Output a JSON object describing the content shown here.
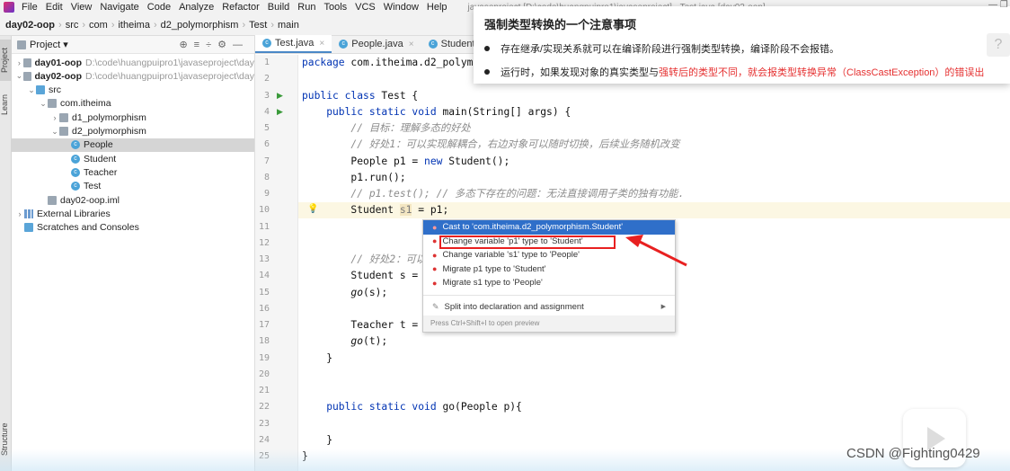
{
  "menubar": {
    "items": [
      "File",
      "Edit",
      "View",
      "Navigate",
      "Code",
      "Analyze",
      "Refactor",
      "Build",
      "Run",
      "Tools",
      "VCS",
      "Window",
      "Help"
    ],
    "window_title": "javaseproject [D:\\code\\huangpuipro1\\javaseproject] - Test.java [day02-oop]"
  },
  "breadcrumb": [
    "day02-oop",
    "src",
    "com",
    "itheima",
    "d2_polymorphism",
    "Test",
    "main"
  ],
  "leftstrip": {
    "project": "Project",
    "learn": "Learn",
    "structure": "Structure"
  },
  "project": {
    "title": "Project ▾",
    "tree": [
      {
        "label": "day01-oop",
        "path": "D:\\code\\huangpuipro1\\javaseproject\\day",
        "arrow": "›",
        "icon": "module",
        "bold": true,
        "depth": 0
      },
      {
        "label": "day02-oop",
        "path": "D:\\code\\huangpuipro1\\javaseproject\\day",
        "arrow": "⌄",
        "icon": "module",
        "bold": true,
        "depth": 0
      },
      {
        "label": "src",
        "arrow": "⌄",
        "icon": "src",
        "depth": 1
      },
      {
        "label": "com.itheima",
        "arrow": "⌄",
        "icon": "folder",
        "depth": 2
      },
      {
        "label": "d1_polymorphism",
        "arrow": "›",
        "icon": "folder",
        "depth": 3
      },
      {
        "label": "d2_polymorphism",
        "arrow": "⌄",
        "icon": "folder",
        "depth": 3
      },
      {
        "label": "People",
        "icon": "class",
        "depth": 4,
        "selected": true
      },
      {
        "label": "Student",
        "icon": "class",
        "depth": 4
      },
      {
        "label": "Teacher",
        "icon": "class",
        "depth": 4
      },
      {
        "label": "Test",
        "icon": "class",
        "depth": 4
      },
      {
        "label": "day02-oop.iml",
        "icon": "file",
        "depth": 2
      },
      {
        "label": "External Libraries",
        "arrow": "›",
        "icon": "lib",
        "depth": 0
      },
      {
        "label": "Scratches and Consoles",
        "icon": "scratch",
        "depth": 0
      }
    ]
  },
  "tabs": [
    {
      "label": "Test.java",
      "active": true
    },
    {
      "label": "People.java"
    },
    {
      "label": "Student.java"
    }
  ],
  "editor": {
    "current_line": 10,
    "lines": [
      [
        {
          "t": "package ",
          "k": "kw"
        },
        {
          "t": "com.itheima.d2_polymo"
        }
      ],
      [],
      [
        {
          "t": "public class ",
          "k": "kw"
        },
        {
          "t": "Test {"
        }
      ],
      [
        {
          "t": "    public static void ",
          "k": "kw"
        },
        {
          "t": "main(String[] args) {"
        }
      ],
      [
        {
          "t": "        // 目标：理解多态的好处",
          "k": "cm"
        }
      ],
      [
        {
          "t": "        // 好处1：可以实现解耦合，右边对象可以随时切换，后续业务随机改变",
          "k": "cm"
        }
      ],
      [
        {
          "t": "        People p1 = "
        },
        {
          "t": "new ",
          "k": "kw"
        },
        {
          "t": "Student();"
        }
      ],
      [
        {
          "t": "        p1.run();"
        }
      ],
      [
        {
          "t": "        // p1.test(); // 多态下存在的问题：无法直接调用子类的独有功能.",
          "k": "cm"
        }
      ],
      [
        {
          "t": "        Student "
        },
        {
          "t": "s1",
          "k": "hl"
        },
        {
          "t": " = p1;"
        }
      ],
      [],
      [],
      [
        {
          "t": "        // 好处2：可以",
          "k": "cm"
        }
      ],
      [
        {
          "t": "        Student s = "
        }
      ],
      [
        {
          "t": "        "
        },
        {
          "t": "go",
          "k": "it"
        },
        {
          "t": "(s);"
        }
      ],
      [],
      [
        {
          "t": "        Teacher t = "
        }
      ],
      [
        {
          "t": "        "
        },
        {
          "t": "go",
          "k": "it"
        },
        {
          "t": "(t);"
        }
      ],
      [
        {
          "t": "    }"
        }
      ],
      [],
      [],
      [
        {
          "t": "    public static void ",
          "k": "kw"
        },
        {
          "t": "go(People p){"
        }
      ],
      [],
      [
        {
          "t": "    }"
        }
      ],
      [
        {
          "t": "}"
        }
      ]
    ],
    "run_markers": [
      3,
      4
    ]
  },
  "intention_menu": {
    "items": [
      {
        "label": "Cast to 'com.itheima.d2_polymorphism.Student'",
        "selected": true
      },
      {
        "label": "Change variable 'p1' type to 'Student'",
        "highlighted": true
      },
      {
        "label": "Change variable 's1' type to 'People'"
      },
      {
        "label": "Migrate p1 type to 'Student'"
      },
      {
        "label": "Migrate s1 type to 'People'"
      }
    ],
    "split": "Split into declaration and assignment",
    "footer": "Press Ctrl+Shift+I to open preview"
  },
  "note": {
    "title": "强制类型转换的一个注意事项",
    "bullet1": "存在继承/实现关系就可以在编译阶段进行强制类型转换，编译阶段不会报错。",
    "bullet2_a": "运行时，如果发现对象的真实类型与",
    "bullet2_b": "强转后的类型不同，就会报类型转换异常（ClassCastException）的错误出",
    "help": "?"
  },
  "watermark": "CSDN @Fighting0429",
  "colors": {
    "accent": "#2f6fc9",
    "annotation": "#e82020"
  }
}
